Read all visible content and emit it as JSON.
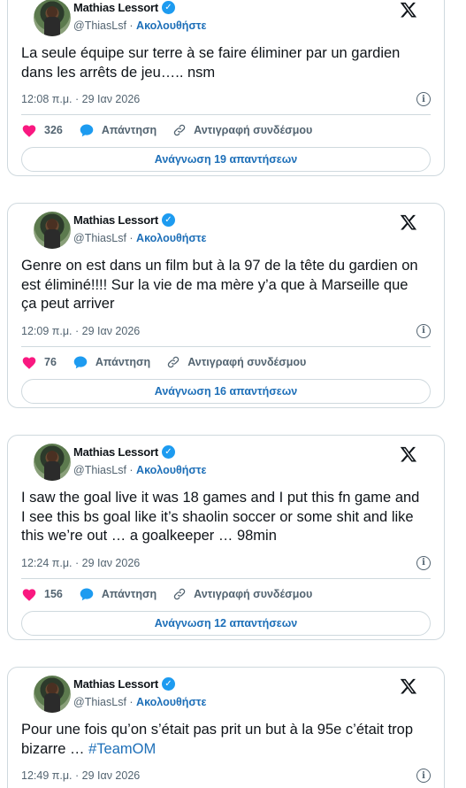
{
  "tweets": [
    {
      "name": "Mathias Lessort",
      "handle": "@ThiasLsf",
      "sep": " · ",
      "follow": "Ακολουθήστε",
      "text": "La seule équipe sur terre à se faire éliminer par un gardien dans les arrêts de jeu….. nsm",
      "hashtag": "",
      "time": "12:08 π.μ. · 29 Ιαν 2026",
      "likes": "326",
      "reply": "Απάντηση",
      "copy_link": "Αντιγραφή συνδέσμου",
      "read_replies": "Ανάγνωση 19 απαντήσεων"
    },
    {
      "name": "Mathias Lessort",
      "handle": "@ThiasLsf",
      "sep": " · ",
      "follow": "Ακολουθήστε",
      "text": "Genre on est dans un film but à la 97 de la tête du gardien on est éliminé!!!! Sur la vie de ma mère y’a que à Marseille que ça peut arriver",
      "hashtag": "",
      "time": "12:09 π.μ. · 29 Ιαν 2026",
      "likes": "76",
      "reply": "Απάντηση",
      "copy_link": "Αντιγραφή συνδέσμου",
      "read_replies": "Ανάγνωση 16 απαντήσεων"
    },
    {
      "name": "Mathias Lessort",
      "handle": "@ThiasLsf",
      "sep": " · ",
      "follow": "Ακολουθήστε",
      "text": "I saw the goal live it was 18 games and I put this fn game and I see this bs goal like it’s shaolin soccer or some shit and like this we’re out … a goalkeeper … 98min",
      "hashtag": "",
      "time": "12:24 π.μ. · 29 Ιαν 2026",
      "likes": "156",
      "reply": "Απάντηση",
      "copy_link": "Αντιγραφή συνδέσμου",
      "read_replies": "Ανάγνωση 12 απαντήσεων"
    },
    {
      "name": "Mathias Lessort",
      "handle": "@ThiasLsf",
      "sep": " · ",
      "follow": "Ακολουθήστε",
      "text": "Pour une fois qu’on s’était pas prit un but à la 95e c’était trop bizarre … ",
      "hashtag": "#TeamOM",
      "time": "12:49 π.μ. · 29 Ιαν 2026",
      "likes": "",
      "reply": "",
      "copy_link": "",
      "read_replies": ""
    }
  ],
  "colors": {
    "accent": "#1d6fb8",
    "verified": "#1d9bf0",
    "like": "#f91880",
    "border": "#cfd9de",
    "muted": "#536471"
  },
  "icons": {
    "verified": "verified-badge-icon",
    "x": "x-logo-icon",
    "like": "heart-icon",
    "reply": "speech-bubble-icon",
    "copy": "link-icon",
    "info": "info-icon"
  }
}
